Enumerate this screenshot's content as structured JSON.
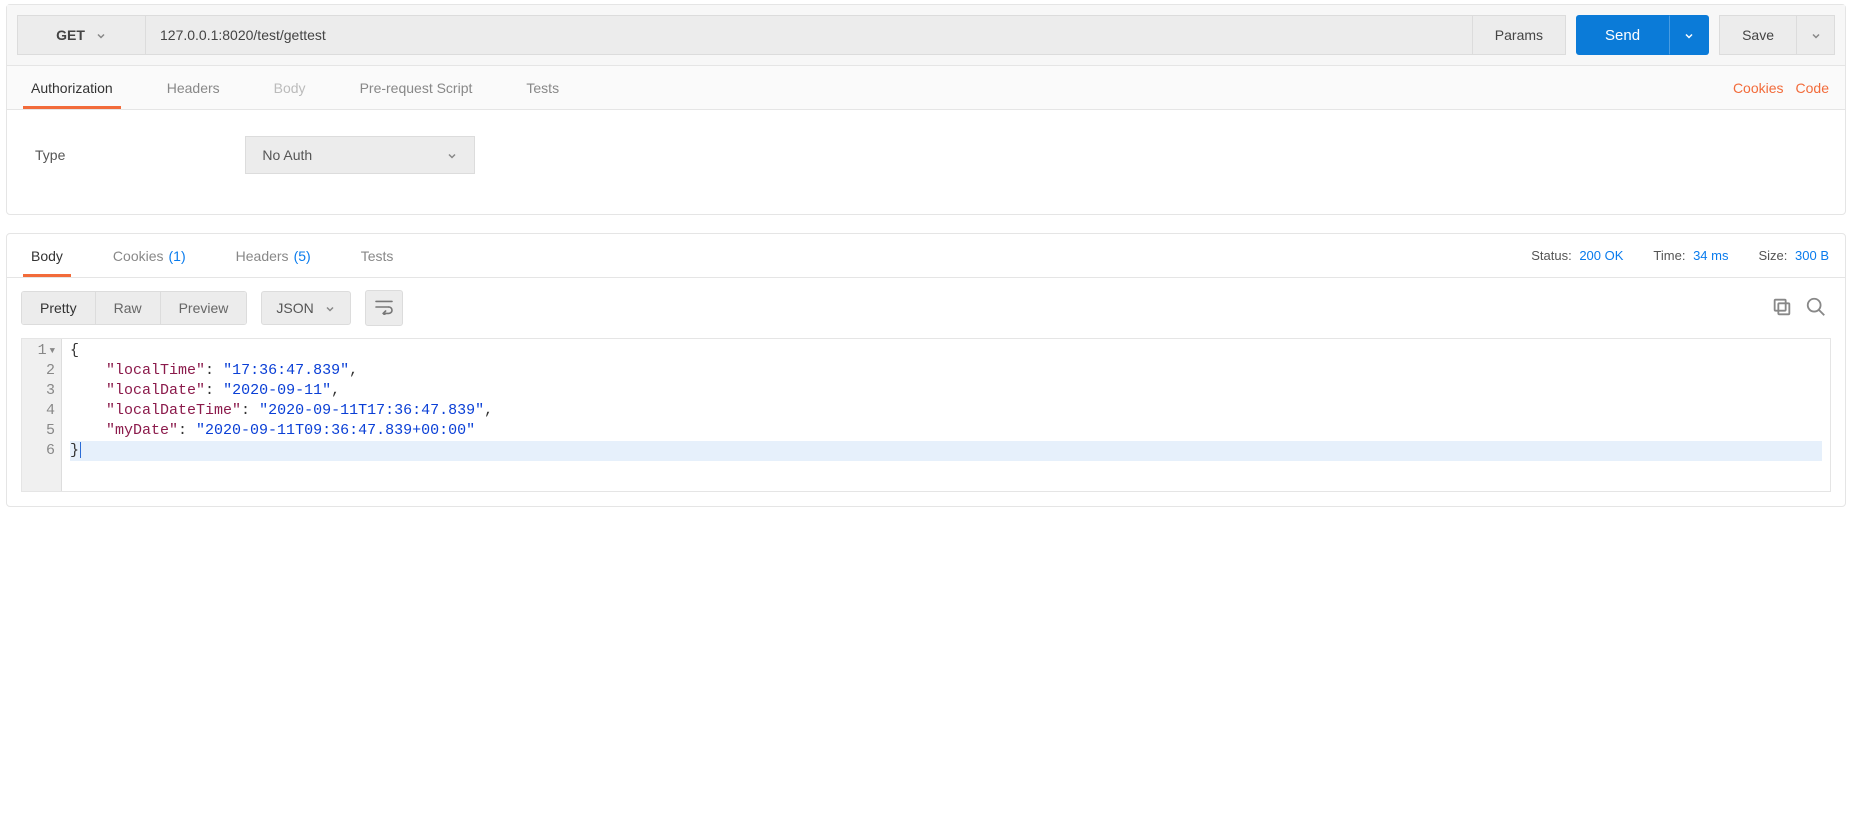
{
  "request": {
    "method": "GET",
    "url": "127.0.0.1:8020/test/gettest",
    "params_btn": "Params",
    "send_btn": "Send",
    "save_btn": "Save"
  },
  "req_tabs": {
    "authorization": "Authorization",
    "headers": "Headers",
    "body": "Body",
    "prerequest": "Pre-request Script",
    "tests": "Tests",
    "cookies_link": "Cookies",
    "code_link": "Code"
  },
  "auth": {
    "type_label": "Type",
    "selected": "No Auth"
  },
  "resp_tabs": {
    "body": "Body",
    "cookies_label": "Cookies",
    "cookies_count": "(1)",
    "headers_label": "Headers",
    "headers_count": "(5)",
    "tests": "Tests"
  },
  "resp_meta": {
    "status_label": "Status:",
    "status_value": "200 OK",
    "time_label": "Time:",
    "time_value": "34 ms",
    "size_label": "Size:",
    "size_value": "300 B"
  },
  "body_toolbar": {
    "pretty": "Pretty",
    "raw": "Raw",
    "preview": "Preview",
    "format": "JSON"
  },
  "json_body": {
    "line1_open": "{",
    "k_localTime": "\"localTime\"",
    "v_localTime": "\"17:36:47.839\"",
    "k_localDate": "\"localDate\"",
    "v_localDate": "\"2020-09-11\"",
    "k_localDateTime": "\"localDateTime\"",
    "v_localDateTime": "\"2020-09-11T17:36:47.839\"",
    "k_myDate": "\"myDate\"",
    "v_myDate": "\"2020-09-11T09:36:47.839+00:00\"",
    "line6_close": "}"
  },
  "gutter": [
    "1",
    "2",
    "3",
    "4",
    "5",
    "6"
  ]
}
